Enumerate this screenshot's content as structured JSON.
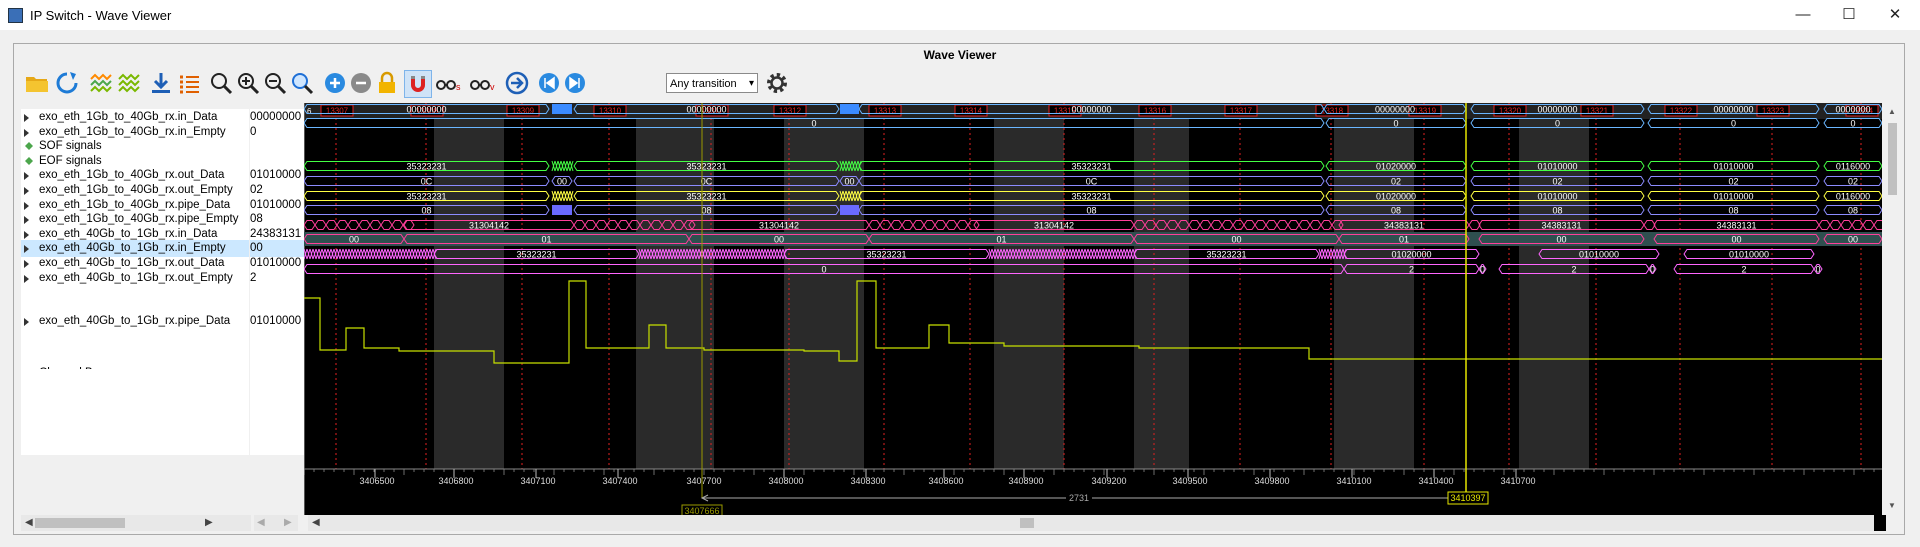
{
  "window": {
    "title": "IP Switch - Wave Viewer"
  },
  "panel": {
    "title": "Wave Viewer"
  },
  "toolbar": {
    "transition_select": "Any transition",
    "search_options": "Any transition"
  },
  "signals": [
    {
      "name": "exo_eth_1Gb_to_40Gb_rx.in_Data",
      "value": "00000000",
      "expandable": true
    },
    {
      "name": "exo_eth_1Gb_to_40Gb_rx.in_Empty",
      "value": "0",
      "expandable": true
    },
    {
      "name": "SOF signals",
      "value": "",
      "group": true
    },
    {
      "name": "EOF signals",
      "value": "",
      "group": true
    },
    {
      "name": "exo_eth_1Gb_to_40Gb_rx.out_Data",
      "value": "01010000",
      "expandable": true
    },
    {
      "name": "exo_eth_1Gb_to_40Gb_rx.out_Empty",
      "value": "02",
      "expandable": true
    },
    {
      "name": "exo_eth_1Gb_to_40Gb_rx.pipe_Data",
      "value": "01010000",
      "expandable": true
    },
    {
      "name": "exo_eth_1Gb_to_40Gb_rx.pipe_Empty",
      "value": "08",
      "expandable": true
    },
    {
      "name": "exo_eth_40Gb_to_1Gb_rx.in_Data",
      "value": "24383131",
      "expandable": true
    },
    {
      "name": "exo_eth_40Gb_to_1Gb_rx.in_Empty",
      "value": "00",
      "expandable": true,
      "selected": true
    },
    {
      "name": "exo_eth_40Gb_to_1Gb_rx.out_Data",
      "value": "01010000",
      "expandable": true
    },
    {
      "name": "exo_eth_40Gb_to_1Gb_rx.out_Empty",
      "value": "2",
      "expandable": true
    },
    {
      "name": "exo_eth_40Gb_to_1Gb_rx.pipe_Data",
      "value": "01010000",
      "expandable": true
    },
    {
      "name": "Channel B",
      "value": ""
    }
  ],
  "markers": {
    "first": "6",
    "labels": [
      "13307",
      "13308",
      "13309",
      "13310",
      "13311",
      "13312",
      "13313",
      "13314",
      "13315",
      "13316",
      "13317",
      "13318",
      "13319",
      "13320",
      "13321",
      "13322",
      "13323",
      "13324"
    ]
  },
  "waves": {
    "in_data": {
      "before_burst": "00000000",
      "between_bursts": "00000000",
      "after_burst": "00000000",
      "tail": [
        "00000000",
        "00000000",
        "00000000",
        "00000000"
      ],
      "tail_clipped": "0000000"
    },
    "in_empty": {
      "main": "0",
      "tail": [
        "0",
        "0",
        "0",
        "0"
      ]
    },
    "out_data": {
      "segments": [
        "35323231",
        "35323231",
        "35323231",
        "01020000",
        "01010000",
        "01010000"
      ],
      "clipped": "0116000"
    },
    "out_empty": {
      "a": "0C",
      "b": "00",
      "c": "0C",
      "d": "00",
      "e": "0C",
      "f": "02",
      "g": "02",
      "h": "02",
      "i": "02"
    },
    "pipe_data": {
      "segments": [
        "35323231",
        "35323231",
        "35323231",
        "01020000",
        "01010000",
        "01010000"
      ],
      "clipped": "0116000"
    },
    "pipe_empty": {
      "segments": [
        "08",
        "08",
        "08",
        "08",
        "08",
        "08",
        "08"
      ]
    },
    "r_in_data": {
      "segments": [
        "31304142",
        "31304142",
        "31304142",
        "34383131",
        "34383131",
        "34383131"
      ]
    },
    "r_in_empty": {
      "segments": [
        "00",
        "01",
        "00",
        "01",
        "00",
        "01",
        "00",
        "00",
        "00"
      ]
    },
    "r_out_data": {
      "segments": [
        "35323231",
        "35323231",
        "35323231",
        "01020000",
        "01010000",
        "01010000"
      ]
    },
    "r_out_empty": {
      "main": "0",
      "a": "2",
      "b": "2",
      "c": "2",
      "zeros": [
        "0",
        "0",
        "0"
      ]
    }
  },
  "timeline": {
    "ticks": [
      "3406500",
      "3406800",
      "3407100",
      "3407400",
      "3407700",
      "3408000",
      "3408300",
      "3408600",
      "3408900",
      "3409200",
      "3409500",
      "3409800",
      "3410100",
      "3410400",
      "3410700"
    ],
    "cursor_left": "3407666",
    "cursor_right": "3410397",
    "delta": "2731"
  },
  "colors": {
    "background": "#000000",
    "marker": "#e02020",
    "cursor": "#e6e600",
    "in_data": "#6ab6ff",
    "out_data": "#44ff44",
    "empty": "#8c8cff",
    "pipe_data": "#ffff44",
    "r_in_data": "#ff3f9a",
    "r_out_data": "#ff66ff",
    "analog": "#c8e000",
    "burst": "#3b8bff"
  }
}
